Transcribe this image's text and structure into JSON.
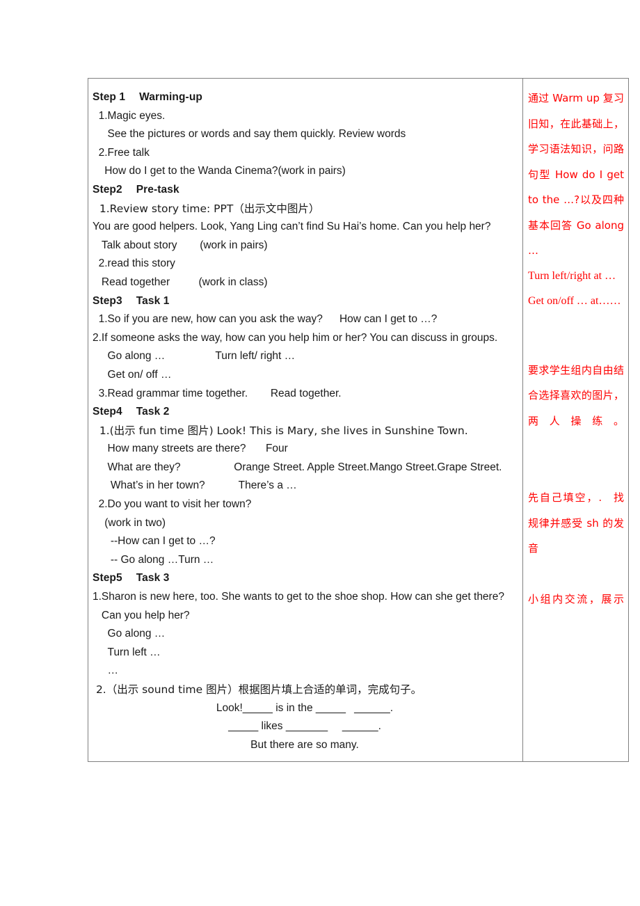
{
  "document": {
    "type": "lesson-plan-table",
    "columns": [
      "teaching-procedure",
      "design-notes"
    ],
    "note_color": "#ff0000",
    "border_color": "#808080"
  },
  "procedure": {
    "blocks": [
      {
        "id": "step1_head",
        "style": "bold",
        "text": "Step 1  Warming-up"
      },
      {
        "id": "step1_1",
        "style": "plain",
        "text": "  1.Magic eyes."
      },
      {
        "id": "step1_1a",
        "style": "plain",
        "text": "     See the pictures or words and say them quickly. Review words"
      },
      {
        "id": "step1_2",
        "style": "plain",
        "text": "  2.Free talk"
      },
      {
        "id": "step1_2a",
        "style": "plain",
        "text": "    How do I get to the Wanda Cinema?(work in pairs)"
      },
      {
        "id": "step2_head",
        "style": "bold",
        "text": "Step2  Pre-task"
      },
      {
        "id": "step2_1",
        "style": "plain",
        "text": "  1.Review story time: PPT（出示文中图片）"
      },
      {
        "id": "step2_1a",
        "style": "justify",
        "text": "     You are good helpers. Look, Yang Ling can’t find Su Hai’s home. Can you help her?"
      },
      {
        "id": "step2_1b",
        "style": "plain",
        "text": "   Talk about story     (work in pairs)"
      },
      {
        "id": "step2_2",
        "style": "plain",
        "text": "  2.read this story"
      },
      {
        "id": "step2_2a",
        "style": "plain",
        "text": "   Read together       (work in class)"
      },
      {
        "id": "step3_head",
        "style": "bold",
        "text": "Step3  Task 1"
      },
      {
        "id": "step3_1",
        "style": "plain",
        "text": "  1.So if you are new, how can you ask the way?   How can I get to …?"
      },
      {
        "id": "step3_2",
        "style": "justify",
        "text": "  2.If someone asks the way, how can you help him or her? You can discuss in groups."
      },
      {
        "id": "step3_2a",
        "style": "plain",
        "text": "     Go along …         Turn left/ right …"
      },
      {
        "id": "step3_2b",
        "style": "plain",
        "text": "     Get on/ off …"
      },
      {
        "id": "step3_3",
        "style": "plain",
        "text": "  3.Read grammar time together.     Read together."
      },
      {
        "id": "step4_head",
        "style": "bold",
        "text": "Step4  Task 2"
      },
      {
        "id": "step4_1",
        "style": "plain",
        "text": "  1.(出示 fun time 图片) Look! This is Mary, she lives in Sunshine Town."
      },
      {
        "id": "step4_1a",
        "style": "plain",
        "text": "     How many streets are there?    Four"
      },
      {
        "id": "step4_1b",
        "style": "plain",
        "text": "     What are they?          Orange Street. Apple Street.Mango Street.Grape Street."
      },
      {
        "id": "step4_1c",
        "style": "plain",
        "text": "      What’s in her town?      There’s a …"
      },
      {
        "id": "step4_2",
        "style": "plain",
        "text": "  2.Do you want to visit her town?"
      },
      {
        "id": "step4_2a",
        "style": "plain",
        "text": "    (work in two)"
      },
      {
        "id": "step4_2b",
        "style": "plain",
        "text": "      --How can I get to …?"
      },
      {
        "id": "step4_2c",
        "style": "plain",
        "text": "      -- Go along …Turn …"
      },
      {
        "id": "step5_head",
        "style": "bold",
        "text": "Step5  Task 3"
      },
      {
        "id": "step5_1",
        "style": "justify",
        "text": "  1.Sharon is new here, too. She wants to get to the shoe shop. How can she get there?"
      },
      {
        "id": "step5_1a",
        "style": "plain",
        "text": "   Can you help her?"
      },
      {
        "id": "step5_1b",
        "style": "plain",
        "text": "     Go along …"
      },
      {
        "id": "step5_1c",
        "style": "plain",
        "text": "     Turn left …"
      },
      {
        "id": "step5_1d",
        "style": "plain",
        "text": "     …"
      },
      {
        "id": "step5_2",
        "style": "plain",
        "text": " 2.（出示 sound time 图片）根据图片填上合适的单词，完成句子。"
      },
      {
        "id": "blank_1",
        "style": "center",
        "text": "Look!_____ is in the _____  ______."
      },
      {
        "id": "blank_2",
        "style": "center",
        "text": "_____ likes _______    ______."
      },
      {
        "id": "blank_3",
        "style": "center",
        "text": "But there are so many."
      }
    ]
  },
  "notes": {
    "blocks": [
      {
        "id": "note1a",
        "font": "sans",
        "text": "通过 Warm up 复习旧知，在此基础上，学习语法知识，问路句型 How do I get to the …?以及四种基本回答 Go along …"
      },
      {
        "id": "note1b",
        "font": "serif",
        "text": "Turn left/right at …  Get on/off … at……"
      },
      {
        "id": "note2",
        "font": "sans",
        "text": "要求学生组内自由结合选择喜欢的图片，两人操练。"
      },
      {
        "id": "note3",
        "font": "sans",
        "text": "先自己填空，. 找规律并感受 sh 的发音"
      },
      {
        "id": "note4",
        "font": "sans",
        "text": "小组内交流，展示"
      }
    ]
  }
}
